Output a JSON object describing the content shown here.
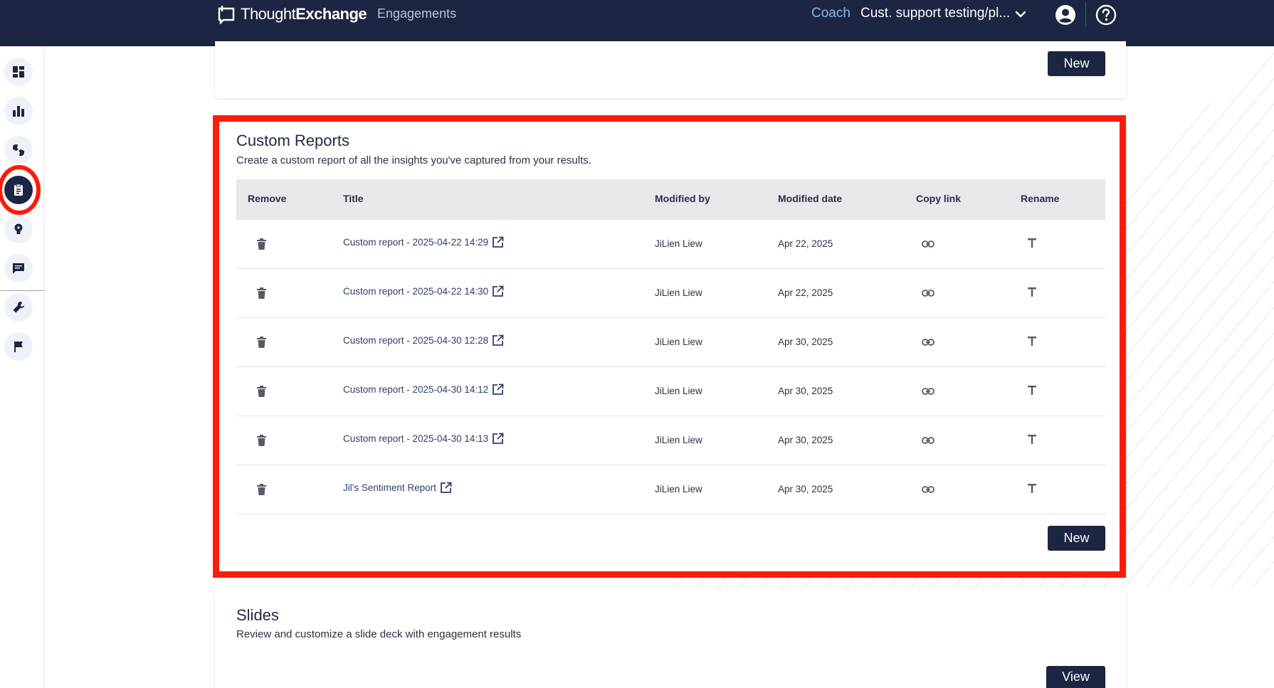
{
  "header": {
    "brand_light": "Thought",
    "brand_bold": "Exchange",
    "nav_engagements": "Engagements",
    "coach": "Coach",
    "workspace": "Cust. support testing/pl..."
  },
  "rail": {
    "icons": [
      "dashboard-icon",
      "bar-chart-icon",
      "thumbs-icon",
      "clipboard-report-icon",
      "lightbulb-icon",
      "chat-icon",
      "wrench-icon",
      "flag-icon"
    ],
    "active": "clipboard-report-icon"
  },
  "top_card": {
    "new_label": "New"
  },
  "custom_reports": {
    "title": "Custom Reports",
    "subtitle": "Create a custom report of all the insights you've captured from your results.",
    "columns": [
      "Remove",
      "Title",
      "Modified by",
      "Modified date",
      "Copy link",
      "Rename"
    ],
    "rows": [
      {
        "title": "Custom report - 2025-04-22 14:29",
        "modified_by": "JiLien Liew",
        "modified_date": "Apr 22, 2025"
      },
      {
        "title": "Custom report - 2025-04-22 14:30",
        "modified_by": "JiLien Liew",
        "modified_date": "Apr 22, 2025"
      },
      {
        "title": "Custom report - 2025-04-30 12:28",
        "modified_by": "JiLien Liew",
        "modified_date": "Apr 30, 2025"
      },
      {
        "title": "Custom report - 2025-04-30 14:12",
        "modified_by": "JiLien Liew",
        "modified_date": "Apr 30, 2025"
      },
      {
        "title": "Custom report - 2025-04-30 14:13",
        "modified_by": "JiLien Liew",
        "modified_date": "Apr 30, 2025"
      },
      {
        "title": "Jil's Sentiment Report",
        "modified_by": "JiLien Liew",
        "modified_date": "Apr 30, 2025"
      }
    ],
    "new_label": "New"
  },
  "slides": {
    "title": "Slides",
    "subtitle": "Review and customize a slide deck with engagement results",
    "view_label": "View"
  },
  "colors": {
    "navy": "#1c2541",
    "highlight_red": "#ff1a0a",
    "coach_blue": "#8fb3e8"
  }
}
